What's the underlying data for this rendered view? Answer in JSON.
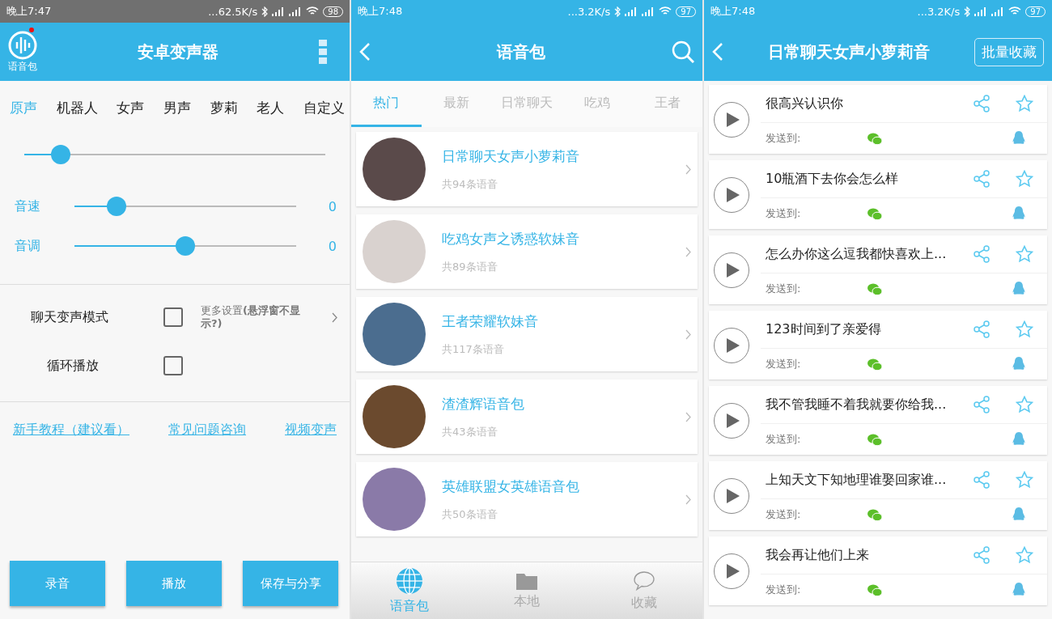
{
  "voice_changer": {
    "status_bar": {
      "time": "晚上7:47",
      "speed": "...62.5K/s",
      "battery": "98"
    },
    "app_bar": {
      "pack_label": "语音包",
      "title": "安卓变声器",
      "notification": true
    },
    "voice_tabs": [
      {
        "label": "原声",
        "selected": true
      },
      {
        "label": "机器人",
        "selected": false
      },
      {
        "label": "女声",
        "selected": false
      },
      {
        "label": "男声",
        "selected": false
      },
      {
        "label": "萝莉",
        "selected": false
      },
      {
        "label": "老人",
        "selected": false
      },
      {
        "label": "自定义",
        "selected": false
      }
    ],
    "pitch_slider": {
      "level": 0.12
    },
    "sliders": [
      {
        "label": "音速",
        "level": 0.19,
        "reading": "0"
      },
      {
        "label": "音调",
        "level": 0.5,
        "reading": "0"
      }
    ],
    "options": [
      {
        "label": "聊天变声模式",
        "checked": false,
        "more": "更多设置**(悬浮窗不显示?)**"
      },
      {
        "label": "循环播放",
        "checked": false
      }
    ],
    "links": [
      "新手教程（建议看）",
      "常见问题咨询",
      "视频变声"
    ],
    "buttons": [
      "录音",
      "播放",
      "保存与分享"
    ]
  },
  "voice_packs": {
    "status_bar": {
      "time": "晚上7:48",
      "speed": "...3.2K/s",
      "battery": "97"
    },
    "title": "语音包",
    "category_tabs": [
      {
        "label": "热门",
        "selected": true
      },
      {
        "label": "最新",
        "selected": false
      },
      {
        "label": "日常聊天",
        "selected": false
      },
      {
        "label": "吃鸡",
        "selected": false
      },
      {
        "label": "王者",
        "selected": false
      }
    ],
    "packs": [
      {
        "title": "日常聊天女声小萝莉音",
        "count": "共94条语音"
      },
      {
        "title": "吃鸡女声之诱惑软妹音",
        "count": "共89条语音"
      },
      {
        "title": "王者荣耀软妹音",
        "count": "共117条语音"
      },
      {
        "title": "渣渣辉语音包",
        "count": "共43条语音"
      },
      {
        "title": "英雄联盟女英雄语音包",
        "count": "共50条语音"
      }
    ],
    "bottom_nav": [
      {
        "label": "语音包",
        "kind": "globe",
        "selected": true
      },
      {
        "label": "本地",
        "kind": "folder",
        "selected": false
      },
      {
        "label": "收藏",
        "kind": "chat",
        "selected": false
      }
    ]
  },
  "pack_detail": {
    "status_bar": {
      "time": "晚上7:48",
      "speed": "...3.2K/s",
      "battery": "97"
    },
    "title": "日常聊天女声小萝莉音",
    "action_button": "批量收藏",
    "clips": [
      {
        "title": "很高兴认识你",
        "send_label": "发送到:",
        "favorited": false
      },
      {
        "title": "10瓶酒下去你会怎么样",
        "send_label": "发送到:",
        "favorited": false
      },
      {
        "title": "怎么办你这么逗我都快喜欢上...",
        "send_label": "发送到:",
        "favorited": false
      },
      {
        "title": "123时间到了亲爱得",
        "send_label": "发送到:",
        "favorited": false
      },
      {
        "title": "我不管我睡不着我就要你给我...",
        "send_label": "发送到:",
        "favorited": false
      },
      {
        "title": "上知天文下知地理谁娶回家谁...",
        "send_label": "发送到:",
        "favorited": false
      },
      {
        "title": "我会再让他们上来",
        "send_label": "发送到:",
        "favorited": false
      }
    ]
  }
}
